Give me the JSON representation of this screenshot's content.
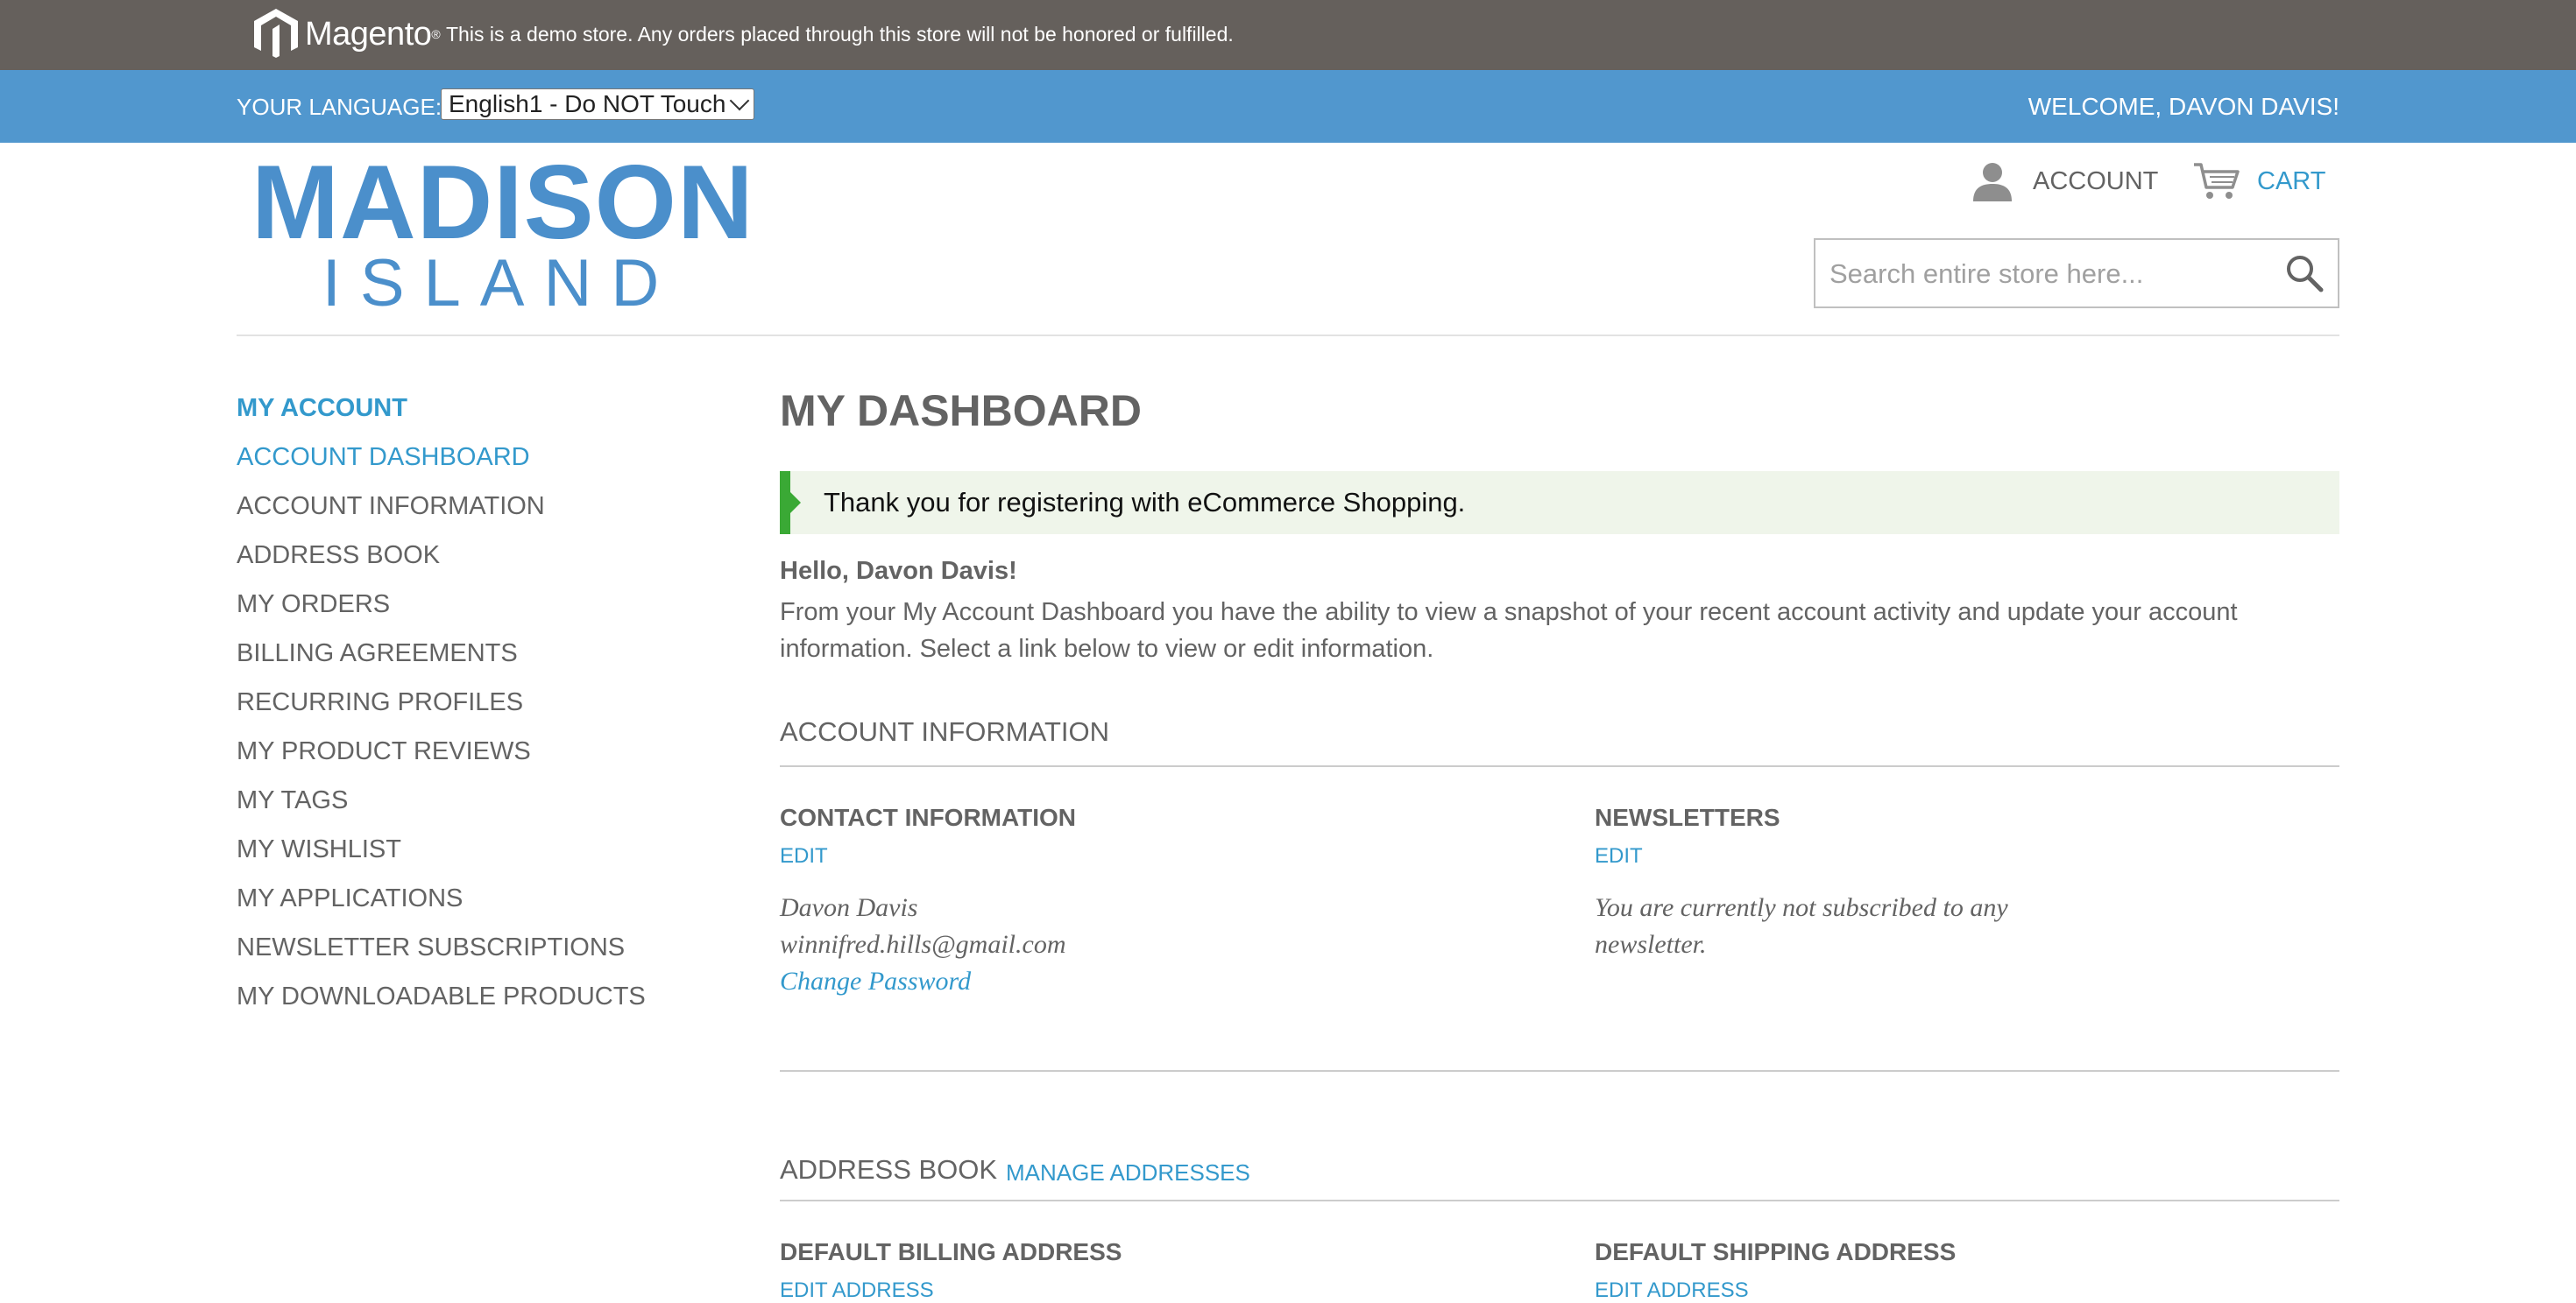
{
  "demo_notice": {
    "brand": "Magento",
    "text": "This is a demo store. Any orders placed through this store will not be honored or fulfilled."
  },
  "language_bar": {
    "label": "YOUR LANGUAGE:",
    "selected_language": "English1 - Do NOT Touch",
    "welcome": "WELCOME, DAVON DAVIS!"
  },
  "header": {
    "logo_top": "MADISON",
    "logo_bottom": "ISLAND",
    "account_label": "ACCOUNT",
    "cart_label": "CART",
    "search_placeholder": "Search entire store here..."
  },
  "sidebar": {
    "title": "MY ACCOUNT",
    "items": [
      {
        "label": "ACCOUNT DASHBOARD",
        "active": true
      },
      {
        "label": "ACCOUNT INFORMATION"
      },
      {
        "label": "ADDRESS BOOK"
      },
      {
        "label": "MY ORDERS"
      },
      {
        "label": "BILLING AGREEMENTS"
      },
      {
        "label": "RECURRING PROFILES"
      },
      {
        "label": "MY PRODUCT REVIEWS"
      },
      {
        "label": "MY TAGS"
      },
      {
        "label": "MY WISHLIST"
      },
      {
        "label": "MY APPLICATIONS"
      },
      {
        "label": "NEWSLETTER SUBSCRIPTIONS"
      },
      {
        "label": "MY DOWNLOADABLE PRODUCTS"
      }
    ]
  },
  "main": {
    "title": "MY DASHBOARD",
    "success_message": "Thank you for registering with eCommerce Shopping.",
    "hello": "Hello, Davon Davis!",
    "intro": "From your My Account Dashboard you have the ability to view a snapshot of your recent account activity and update your account information. Select a link below to view or edit information.",
    "account_info": {
      "title": "ACCOUNT INFORMATION",
      "contact": {
        "title": "CONTACT INFORMATION",
        "edit": "EDIT",
        "name": "Davon Davis",
        "email": "winnifred.hills@gmail.com",
        "change_password": "Change Password"
      },
      "newsletters": {
        "title": "NEWSLETTERS",
        "edit": "EDIT",
        "text": "You are currently not subscribed to any newsletter."
      }
    },
    "address_book": {
      "title": "ADDRESS BOOK",
      "manage": "MANAGE ADDRESSES",
      "default_billing": "DEFAULT BILLING ADDRESS",
      "default_shipping": "DEFAULT SHIPPING ADDRESS",
      "billing_edit": "EDIT ADDRESS",
      "shipping_edit": "EDIT ADDRESS"
    }
  },
  "colors": {
    "demo_bar": "#65605c",
    "language_bar": "#5197ce",
    "link": "#3399cc",
    "logo": "#4b8fcb",
    "success_bg": "#eff5ea",
    "success_accent": "#3aa935",
    "text": "#636363"
  }
}
